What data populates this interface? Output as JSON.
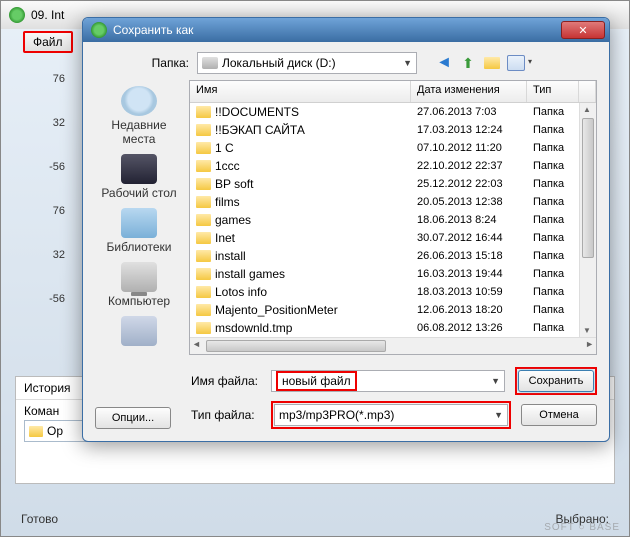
{
  "bg": {
    "title_prefix": "09. Int",
    "file_btn": "Файл",
    "left_values": [
      "76",
      "32",
      "-56",
      "76",
      "32",
      "-56"
    ],
    "history_label": "История",
    "commands_label": "Коман",
    "cmd_text": "Ор",
    "status_left": "Готово",
    "status_right": "Выбрано:"
  },
  "dialog": {
    "title": "Сохранить как",
    "folder_label": "Папка:",
    "folder_value": "Локальный диск (D:)",
    "columns": {
      "name": "Имя",
      "date": "Дата изменения",
      "type": "Тип"
    },
    "sidebar": [
      {
        "label": "Недавние места",
        "icon": "recent"
      },
      {
        "label": "Рабочий стол",
        "icon": "desktop"
      },
      {
        "label": "Библиотеки",
        "icon": "libs"
      },
      {
        "label": "Компьютер",
        "icon": "computer"
      },
      {
        "label": "",
        "icon": "network"
      }
    ],
    "files": [
      {
        "name": "!!DOCUMENTS",
        "date": "27.06.2013 7:03",
        "type": "Папка"
      },
      {
        "name": "!!БЭКАП САЙТА",
        "date": "17.03.2013 12:24",
        "type": "Папка"
      },
      {
        "name": "1 С",
        "date": "07.10.2012 11:20",
        "type": "Папка"
      },
      {
        "name": "1ccc",
        "date": "22.10.2012 22:37",
        "type": "Папка"
      },
      {
        "name": "BP soft",
        "date": "25.12.2012 22:03",
        "type": "Папка"
      },
      {
        "name": "films",
        "date": "20.05.2013 12:38",
        "type": "Папка"
      },
      {
        "name": "games",
        "date": "18.06.2013 8:24",
        "type": "Папка"
      },
      {
        "name": "Inet",
        "date": "30.07.2012 16:44",
        "type": "Папка"
      },
      {
        "name": "install",
        "date": "26.06.2013 15:18",
        "type": "Папка"
      },
      {
        "name": "install games",
        "date": "16.03.2013 19:44",
        "type": "Папка"
      },
      {
        "name": "Lotos info",
        "date": "18.03.2013 10:59",
        "type": "Папка"
      },
      {
        "name": "Majento_PositionMeter",
        "date": "12.06.2013 18:20",
        "type": "Папка"
      },
      {
        "name": "msdownld.tmp",
        "date": "06.08.2012 13:26",
        "type": "Папка"
      }
    ],
    "filename_label": "Имя файла:",
    "filename_value": "новый файл",
    "filetype_label": "Тип файла:",
    "filetype_value": "mp3/mp3PRO(*.mp3)",
    "save_btn": "Сохранить",
    "cancel_btn": "Отмена",
    "options_btn": "Опции..."
  },
  "watermark": "SOFT ○ BASE"
}
